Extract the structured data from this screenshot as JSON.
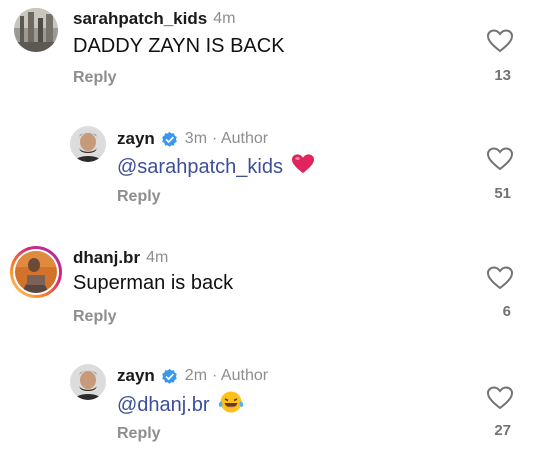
{
  "comments": [
    {
      "username": "sarahpatch_kids",
      "time": "4m",
      "text": "DADDY ZAYN IS BACK",
      "reply_label": "Reply",
      "likes": "13"
    },
    {
      "username": "zayn",
      "time": "3m",
      "author_tag": "· Author",
      "mention": "@sarahpatch_kids",
      "emoji": "red-heart",
      "reply_label": "Reply",
      "likes": "51"
    },
    {
      "username": "dhanj.br",
      "time": "4m",
      "text": "Superman is back",
      "reply_label": "Reply",
      "likes": "6"
    },
    {
      "username": "zayn",
      "time": "2m",
      "author_tag": "· Author",
      "mention": "@dhanj.br",
      "emoji": "laughing-crying-face",
      "reply_label": "Reply",
      "likes": "27"
    }
  ],
  "colors": {
    "mention": "#3e4f99",
    "verified": "#3897f0",
    "muted": "#8e8e8e",
    "heart_emoji": "#e0245e"
  }
}
